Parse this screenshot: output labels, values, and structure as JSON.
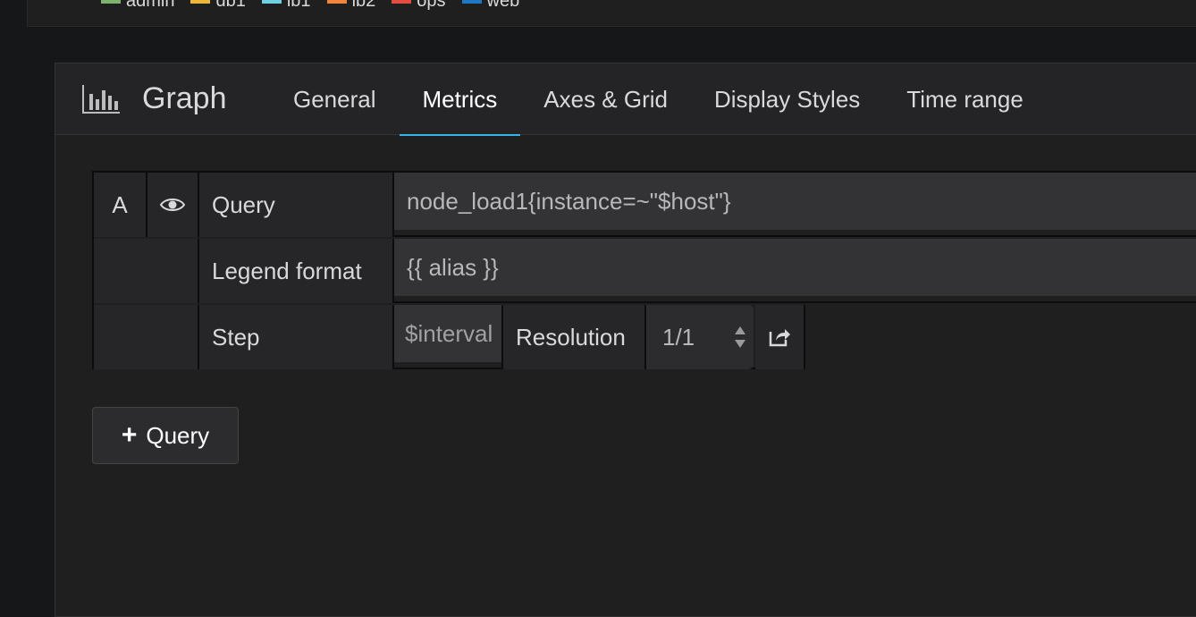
{
  "legend": {
    "items": [
      {
        "label": "admin",
        "color": "#7eb26d"
      },
      {
        "label": "db1",
        "color": "#eab839"
      },
      {
        "label": "lb1",
        "color": "#6ed0e0"
      },
      {
        "label": "lb2",
        "color": "#ef843c"
      },
      {
        "label": "ops",
        "color": "#e24d42"
      },
      {
        "label": "web",
        "color": "#1f78c1"
      }
    ]
  },
  "panel": {
    "title": "Graph",
    "tabs": [
      {
        "label": "General",
        "active": false
      },
      {
        "label": "Metrics",
        "active": true
      },
      {
        "label": "Axes & Grid",
        "active": false
      },
      {
        "label": "Display Styles",
        "active": false
      },
      {
        "label": "Time range",
        "active": false
      }
    ]
  },
  "query": {
    "ref_id": "A",
    "query_label": "Query",
    "query_value": "node_load1{instance=~\"$host\"}",
    "legend_label": "Legend format",
    "legend_value": "{{ alias }}",
    "step_label": "Step",
    "step_value": "$interval",
    "resolution_label": "Resolution",
    "resolution_value": "1/1"
  },
  "add_query_label": "Query",
  "colors": {
    "accent": "#33b5e5",
    "background": "#161719",
    "panel": "#1f1f20"
  }
}
